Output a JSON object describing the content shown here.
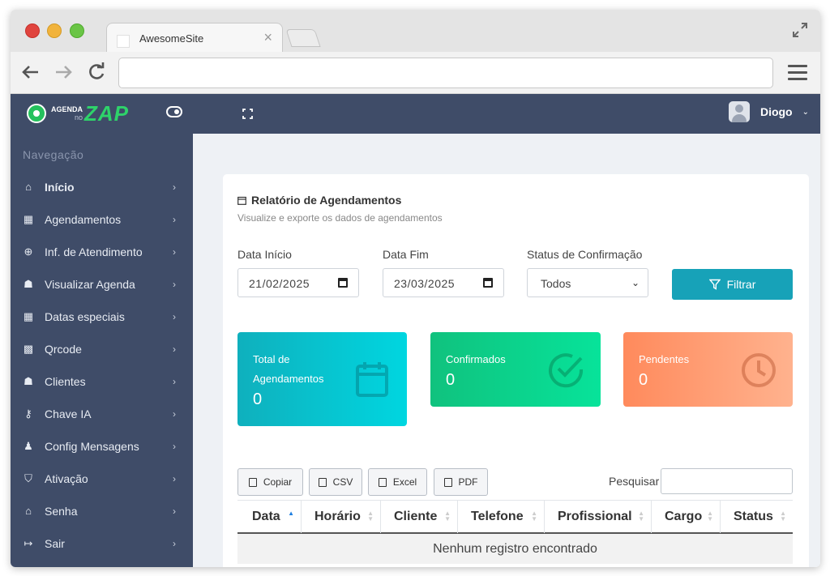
{
  "browser": {
    "tab_title": "AwesomeSite",
    "tab_close": "×",
    "url": ""
  },
  "app": {
    "logo_small": "AGENDA",
    "logo_no": "no",
    "logo_main": "ZAP",
    "user_name": "Diogo",
    "user_caret": "⌄"
  },
  "sidebar": {
    "title": "Navegação",
    "items": [
      {
        "label": "Início",
        "icon": "home-icon",
        "glyph": "⌂",
        "arrow": "›"
      },
      {
        "label": "Agendamentos",
        "icon": "calendar-icon",
        "glyph": "▦",
        "arrow": "›"
      },
      {
        "label": "Inf. de Atendimento",
        "icon": "plus-circle-icon",
        "glyph": "⊕",
        "arrow": "›"
      },
      {
        "label": "Visualizar Agenda",
        "icon": "users-icon",
        "glyph": "☗",
        "arrow": "›"
      },
      {
        "label": "Datas especiais",
        "icon": "calendar-icon",
        "glyph": "▦",
        "arrow": "›"
      },
      {
        "label": "Qrcode",
        "icon": "qrcode-icon",
        "glyph": "▩",
        "arrow": "›"
      },
      {
        "label": "Clientes",
        "icon": "users-icon",
        "glyph": "☗",
        "arrow": "›"
      },
      {
        "label": "Chave IA",
        "icon": "key-icon",
        "glyph": "⚷",
        "arrow": "›"
      },
      {
        "label": "Config Mensagens",
        "icon": "user-icon",
        "glyph": "♟",
        "arrow": "›"
      },
      {
        "label": "Ativação",
        "icon": "shield-icon",
        "glyph": "⛉",
        "arrow": "›"
      },
      {
        "label": "Senha",
        "icon": "lock-icon",
        "glyph": "⌂",
        "arrow": "›"
      },
      {
        "label": "Sair",
        "icon": "logout-icon",
        "glyph": "↦",
        "arrow": "›"
      }
    ]
  },
  "report": {
    "title": "Relatório de Agendamentos",
    "subtitle": "Visualize e exporte os dados de agendamentos",
    "start_label": "Data Início",
    "start_value": "21/02/2025",
    "end_label": "Data Fim",
    "end_value": "23/03/2025",
    "status_label": "Status de Confirmação",
    "status_value": "Todos",
    "status_chevron": "⌄",
    "filter_label": "Filtrar"
  },
  "stats": {
    "total_label": "Total de Agendamentos",
    "total_value": "0",
    "confirmed_label": "Confirmados",
    "confirmed_value": "0",
    "pending_label": "Pendentes",
    "pending_value": "0"
  },
  "table": {
    "buttons": {
      "copy": "Copiar",
      "csv": "CSV",
      "excel": "Excel",
      "pdf": "PDF"
    },
    "search_label": "Pesquisar",
    "search_value": "",
    "columns": [
      "Data",
      "Horário",
      "Cliente",
      "Telefone",
      "Profissional",
      "Cargo",
      "Status"
    ],
    "empty_message": "Nenhum registro encontrado"
  },
  "colors": {
    "sidebar_bg": "#3f4c68",
    "accent": "#17a2b8",
    "total_card": "#0fb0bd",
    "confirmed_card": "#10c27e",
    "pending_card": "#ff8a5c"
  }
}
